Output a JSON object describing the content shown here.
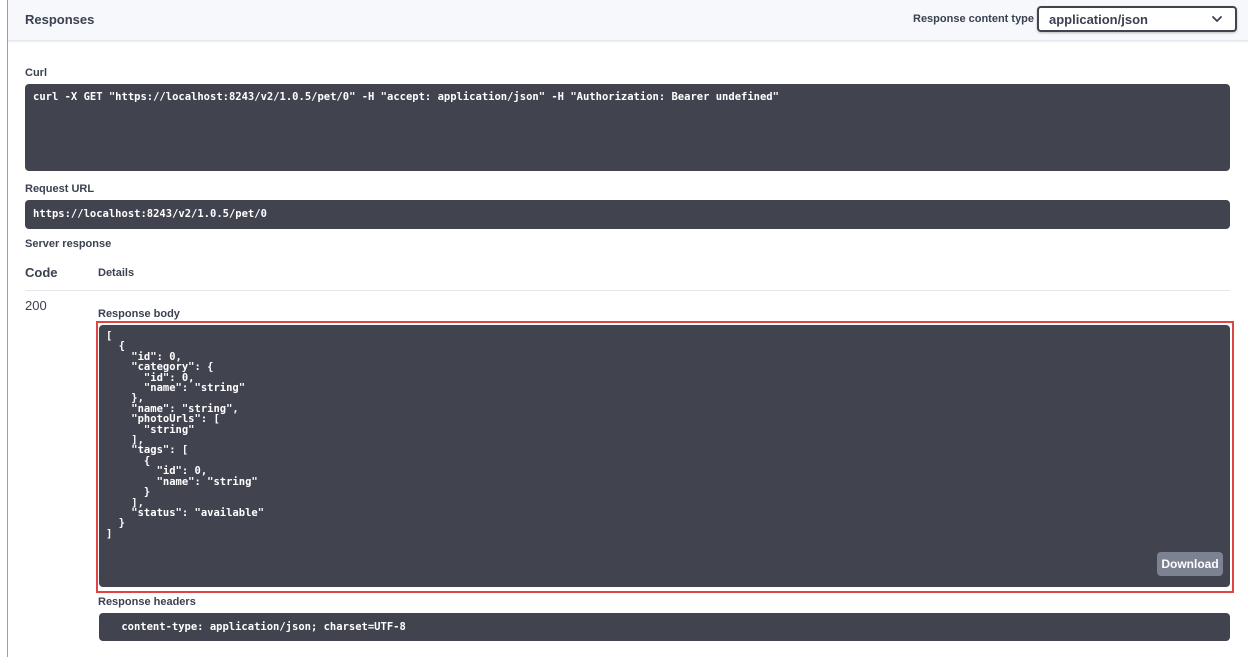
{
  "header": {
    "title": "Responses",
    "content_type_label": "Response content type",
    "content_type_value": "application/json"
  },
  "curl": {
    "label": "Curl",
    "command": "curl -X GET \"https://localhost:8243/v2/1.0.5/pet/0\" -H \"accept: application/json\" -H \"Authorization: Bearer undefined\""
  },
  "request_url": {
    "label": "Request URL",
    "value": "https://localhost:8243/v2/1.0.5/pet/0"
  },
  "server_response": {
    "label": "Server response",
    "code_header": "Code",
    "details_header": "Details",
    "code": "200",
    "body_label": "Response body",
    "body": "[\n  {\n    \"id\": 0,\n    \"category\": {\n      \"id\": 0,\n      \"name\": \"string\"\n    },\n    \"name\": \"string\",\n    \"photoUrls\": [\n      \"string\"\n    ],\n    \"tags\": [\n      {\n        \"id\": 0,\n        \"name\": \"string\"\n      }\n    ],\n    \"status\": \"available\"\n  }\n]",
    "download_label": "Download",
    "headers_label": "Response headers",
    "headers_value": " content-type: application/json; charset=UTF-8 "
  },
  "icons": {
    "select": "chevron-down-icon"
  },
  "colors": {
    "code_background": "#41444e",
    "highlight_border": "#e04545",
    "accent": "#61affe"
  }
}
